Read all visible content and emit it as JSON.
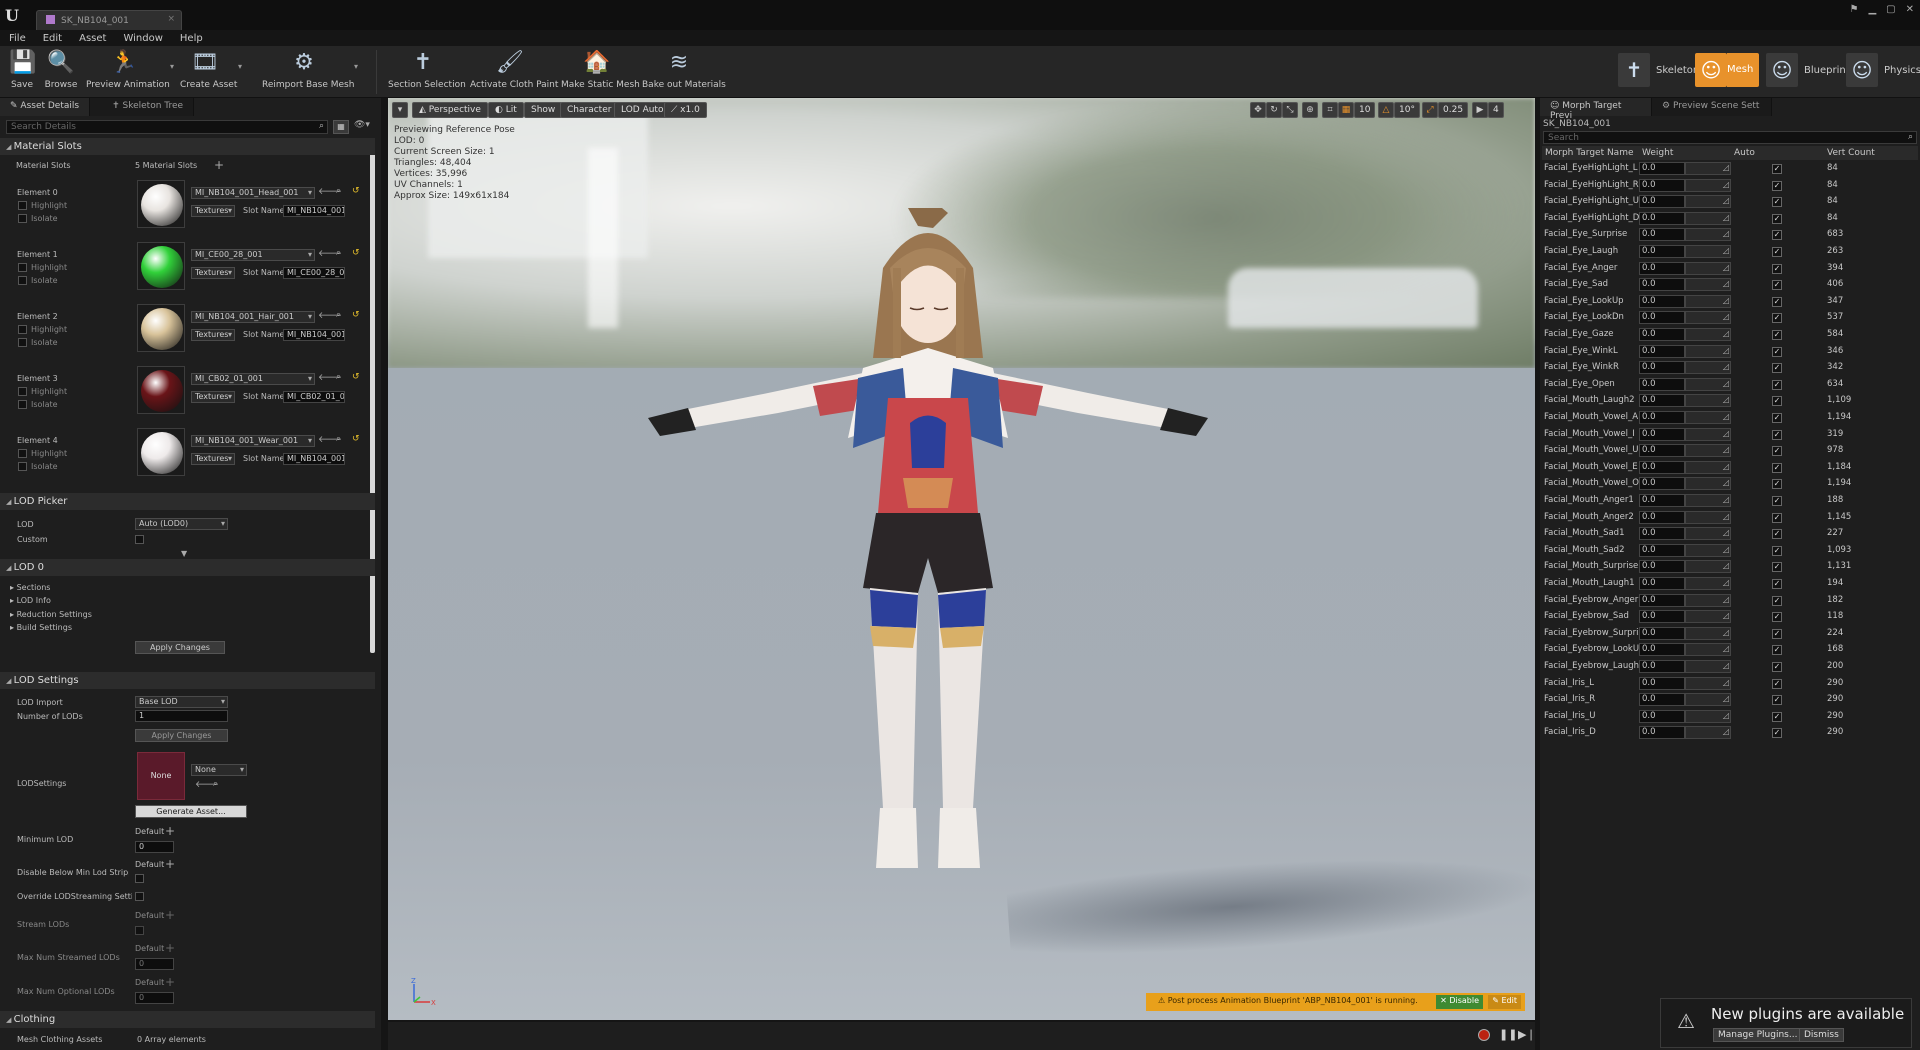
{
  "window": {
    "tab_title": "SK_NB104_001"
  },
  "menu": [
    "File",
    "Edit",
    "Asset",
    "Window",
    "Help"
  ],
  "toolbar": {
    "left": [
      {
        "label": "Save",
        "icon": "save-icon"
      },
      {
        "label": "Browse",
        "icon": "browse-icon"
      },
      {
        "label": "Preview Animation",
        "icon": "preview-animation-icon"
      },
      {
        "label": "Create Asset",
        "icon": "create-asset-icon"
      },
      {
        "label": "Reimport Base Mesh",
        "icon": "reimport-icon"
      },
      {
        "label": "Section Selection",
        "icon": "section-selection-icon"
      },
      {
        "label": "Activate Cloth Paint",
        "icon": "cloth-paint-icon"
      },
      {
        "label": "Make Static Mesh",
        "icon": "static-mesh-icon"
      },
      {
        "label": "Bake out Materials",
        "icon": "bake-materials-icon"
      }
    ],
    "modes": [
      {
        "label": "Skeleton",
        "active": false
      },
      {
        "label": "Mesh",
        "active": true
      },
      {
        "label": "Blueprint",
        "active": false
      },
      {
        "label": "Physics",
        "active": false
      }
    ]
  },
  "left_panel": {
    "tabs": [
      "Asset Details",
      "Skeleton Tree"
    ],
    "search_placeholder": "Search Details",
    "material_slots": {
      "category": "Material Slots",
      "label": "Material Slots",
      "value": "5 Material Slots",
      "elements": [
        {
          "name": "Element 0",
          "highlight": "Highlight",
          "isolate": "Isolate",
          "material": "MI_NB104_001_Head_001",
          "textures": "Textures",
          "slot_label": "Slot Name",
          "slot": "MI_NB104_001_",
          "color": "#e8e4e0"
        },
        {
          "name": "Element 1",
          "highlight": "Highlight",
          "isolate": "Isolate",
          "material": "MI_CE00_28_001",
          "textures": "Textures",
          "slot_label": "Slot Name",
          "slot": "MI_CE00_28_00",
          "color": "#31d13a"
        },
        {
          "name": "Element 2",
          "highlight": "Highlight",
          "isolate": "Isolate",
          "material": "MI_NB104_001_Hair_001",
          "textures": "Textures",
          "slot_label": "Slot Name",
          "slot": "MI_NB104_001_",
          "color": "#d8c39a"
        },
        {
          "name": "Element 3",
          "highlight": "Highlight",
          "isolate": "Isolate",
          "material": "MI_CB02_01_001",
          "textures": "Textures",
          "slot_label": "Slot Name",
          "slot": "MI_CB02_01_00",
          "color": "#6a1418"
        },
        {
          "name": "Element 4",
          "highlight": "Highlight",
          "isolate": "Isolate",
          "material": "MI_NB104_001_Wear_001",
          "textures": "Textures",
          "slot_label": "Slot Name",
          "slot": "MI_NB104_001_",
          "color": "#eeeaea"
        }
      ]
    },
    "lod_picker": {
      "category": "LOD Picker",
      "lod_label": "LOD",
      "lod_value": "Auto (LOD0)",
      "custom_label": "Custom"
    },
    "lod0": {
      "category": "LOD 0",
      "items": [
        "Sections",
        "LOD Info",
        "Reduction Settings",
        "Build Settings"
      ],
      "apply": "Apply Changes"
    },
    "lod_settings": {
      "category": "LOD Settings",
      "lod_import_label": "LOD Import",
      "lod_import_value": "Base LOD",
      "num_lods_label": "Number of LODs",
      "num_lods_value": "1",
      "apply": "Apply Changes",
      "lodsettings_label": "LODSettings",
      "lodsettings_thumb": "None",
      "lodsettings_value": "None",
      "generate": "Generate Asset...",
      "min_lod_label": "Minimum LOD",
      "min_lod_default": "Default",
      "min_lod_value": "0",
      "disable_below_label": "Disable Below Min Lod Stripping",
      "disable_below_default": "Default",
      "override_label": "Override LODStreaming Settings",
      "stream_lods_label": "Stream LODs",
      "stream_lods_default": "Default",
      "max_streamed_label": "Max Num Streamed LODs",
      "max_streamed_default": "Default",
      "max_streamed_value": "0",
      "max_optional_label": "Max Num Optional LODs",
      "max_optional_default": "Default",
      "max_optional_value": "0"
    },
    "clothing": {
      "category": "Clothing",
      "mesh_clothing_label": "Mesh Clothing Assets",
      "mesh_clothing_value": "0 Array elements"
    }
  },
  "viewport": {
    "buttons": [
      "Perspective",
      "Lit",
      "Show",
      "Character",
      "LOD Auto",
      "x1.0"
    ],
    "right_values": [
      "10",
      "10°",
      "0.25",
      "4"
    ],
    "info": [
      "Previewing Reference Pose",
      "LOD: 0",
      "Current Screen Size: 1",
      "Triangles: 48,404",
      "Vertices: 35,996",
      "UV Channels: 1",
      "Approx Size: 149x61x184"
    ],
    "notification": "Post process Animation Blueprint 'ABP_NB104_001' is running.",
    "disable": "Disable",
    "edit": "Edit"
  },
  "right_panel": {
    "tabs": [
      "Morph Target Previ",
      "Preview Scene Sett"
    ],
    "asset_name": "SK_NB104_001",
    "search_placeholder": "Search",
    "columns": [
      "Morph Target Name",
      "Weight",
      "Auto",
      "Vert Count"
    ],
    "rows": [
      {
        "name": "Facial_EyeHighLight_L",
        "weight": "0.0",
        "count": "84"
      },
      {
        "name": "Facial_EyeHighLight_R",
        "weight": "0.0",
        "count": "84"
      },
      {
        "name": "Facial_EyeHighLight_U",
        "weight": "0.0",
        "count": "84"
      },
      {
        "name": "Facial_EyeHighLight_D",
        "weight": "0.0",
        "count": "84"
      },
      {
        "name": "Facial_Eye_Surprise",
        "weight": "0.0",
        "count": "683"
      },
      {
        "name": "Facial_Eye_Laugh",
        "weight": "0.0",
        "count": "263"
      },
      {
        "name": "Facial_Eye_Anger",
        "weight": "0.0",
        "count": "394"
      },
      {
        "name": "Facial_Eye_Sad",
        "weight": "0.0",
        "count": "406"
      },
      {
        "name": "Facial_Eye_LookUp",
        "weight": "0.0",
        "count": "347"
      },
      {
        "name": "Facial_Eye_LookDn",
        "weight": "0.0",
        "count": "537"
      },
      {
        "name": "Facial_Eye_Gaze",
        "weight": "0.0",
        "count": "584"
      },
      {
        "name": "Facial_Eye_WinkL",
        "weight": "0.0",
        "count": "346"
      },
      {
        "name": "Facial_Eye_WinkR",
        "weight": "0.0",
        "count": "342"
      },
      {
        "name": "Facial_Eye_Open",
        "weight": "0.0",
        "count": "634"
      },
      {
        "name": "Facial_Mouth_Laugh2",
        "weight": "0.0",
        "count": "1,109"
      },
      {
        "name": "Facial_Mouth_Vowel_A",
        "weight": "0.0",
        "count": "1,194"
      },
      {
        "name": "Facial_Mouth_Vowel_I",
        "weight": "0.0",
        "count": "319"
      },
      {
        "name": "Facial_Mouth_Vowel_U",
        "weight": "0.0",
        "count": "978"
      },
      {
        "name": "Facial_Mouth_Vowel_E",
        "weight": "0.0",
        "count": "1,184"
      },
      {
        "name": "Facial_Mouth_Vowel_O",
        "weight": "0.0",
        "count": "1,194"
      },
      {
        "name": "Facial_Mouth_Anger1",
        "weight": "0.0",
        "count": "188"
      },
      {
        "name": "Facial_Mouth_Anger2",
        "weight": "0.0",
        "count": "1,145"
      },
      {
        "name": "Facial_Mouth_Sad1",
        "weight": "0.0",
        "count": "227"
      },
      {
        "name": "Facial_Mouth_Sad2",
        "weight": "0.0",
        "count": "1,093"
      },
      {
        "name": "Facial_Mouth_Surprise",
        "weight": "0.0",
        "count": "1,131"
      },
      {
        "name": "Facial_Mouth_Laugh1",
        "weight": "0.0",
        "count": "194"
      },
      {
        "name": "Facial_Eyebrow_Anger",
        "weight": "0.0",
        "count": "182"
      },
      {
        "name": "Facial_Eyebrow_Sad",
        "weight": "0.0",
        "count": "118"
      },
      {
        "name": "Facial_Eyebrow_Surprise",
        "weight": "0.0",
        "count": "224"
      },
      {
        "name": "Facial_Eyebrow_LookUp",
        "weight": "0.0",
        "count": "168"
      },
      {
        "name": "Facial_Eyebrow_Laugh",
        "weight": "0.0",
        "count": "200"
      },
      {
        "name": "Facial_Iris_L",
        "weight": "0.0",
        "count": "290"
      },
      {
        "name": "Facial_Iris_R",
        "weight": "0.0",
        "count": "290"
      },
      {
        "name": "Facial_Iris_U",
        "weight": "0.0",
        "count": "290"
      },
      {
        "name": "Facial_Iris_D",
        "weight": "0.0",
        "count": "290"
      }
    ]
  },
  "toast": {
    "message": "New plugins are available",
    "manage": "Manage Plugins...",
    "dismiss": "Dismiss"
  },
  "colors": {
    "accent": "#e8922b",
    "panel": "#1e1e1e",
    "notify": "#e8a01b"
  }
}
